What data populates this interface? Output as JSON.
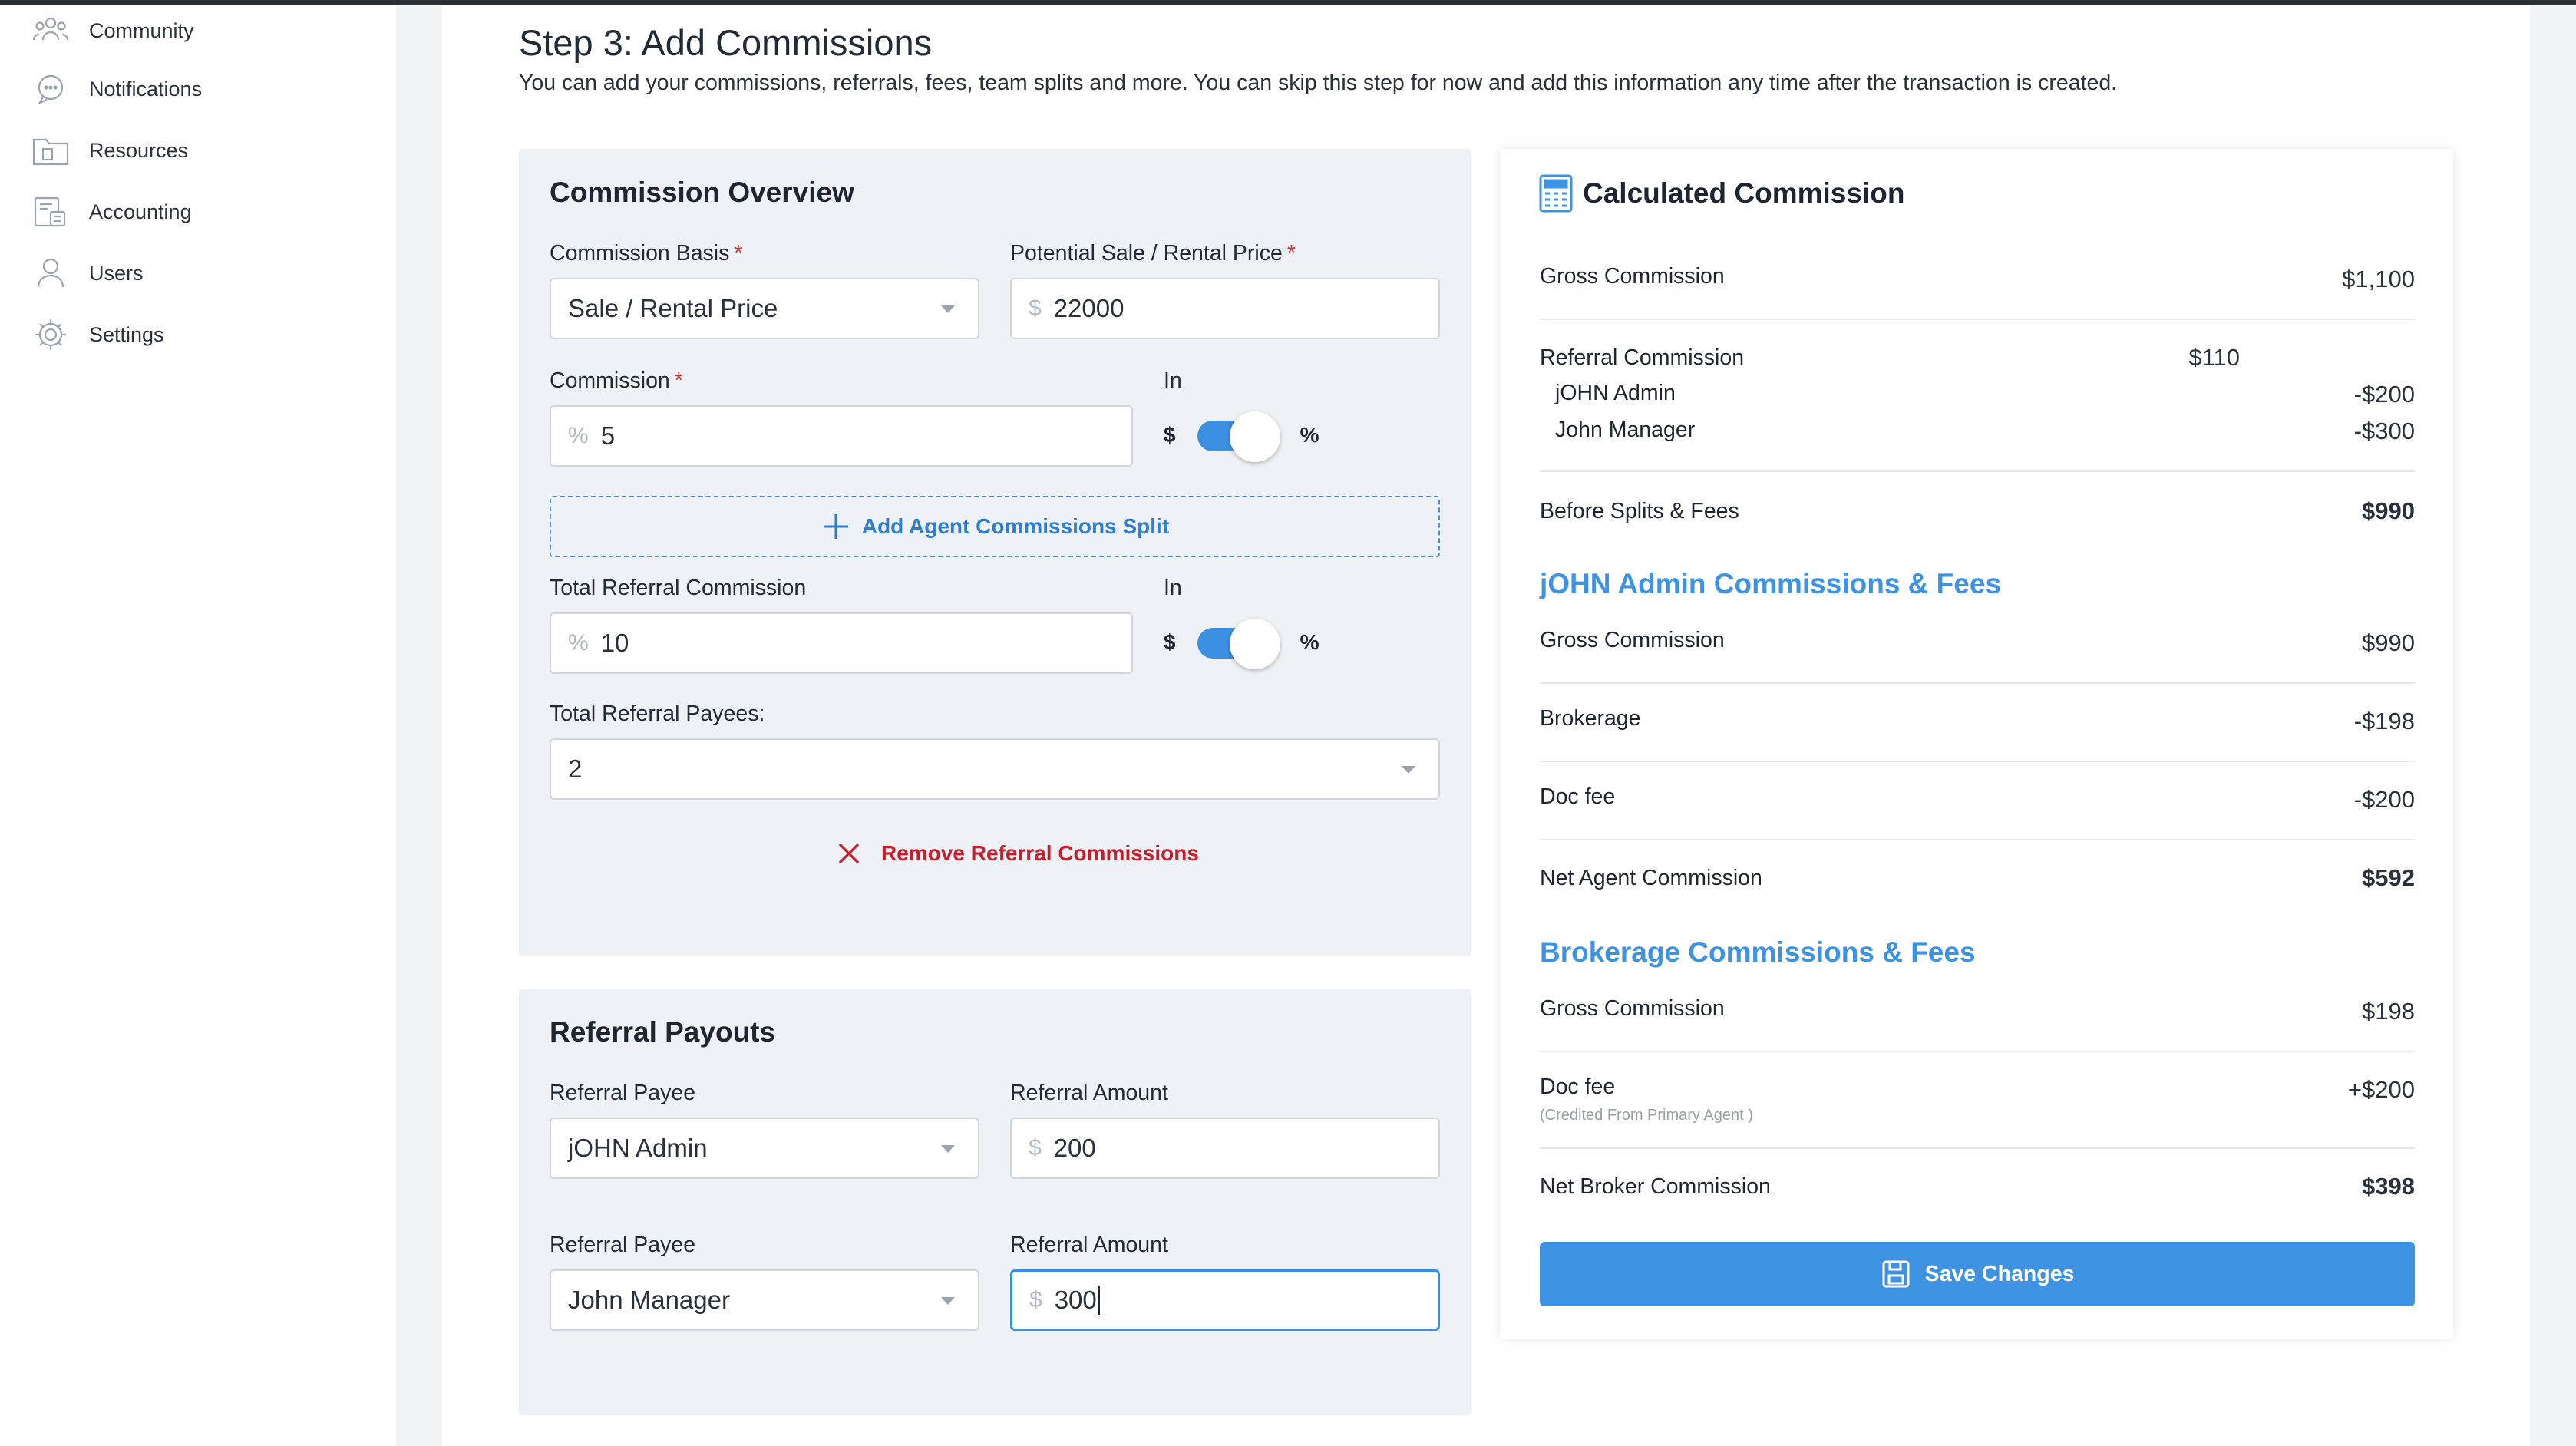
{
  "sidebar": {
    "items": [
      {
        "label": "Community",
        "icon": "community-icon"
      },
      {
        "label": "Notifications",
        "icon": "chat-bubble-icon"
      },
      {
        "label": "Resources",
        "icon": "folder-icon"
      },
      {
        "label": "Accounting",
        "icon": "accounting-icon"
      },
      {
        "label": "Users",
        "icon": "user-icon"
      },
      {
        "label": "Settings",
        "icon": "gear-icon"
      }
    ]
  },
  "page": {
    "title": "Step 3: Add Commissions",
    "description": "You can add your commissions, referrals, fees, team splits and more. You can skip this step for now and add this information any time after the transaction is created."
  },
  "overview": {
    "title": "Commission Overview",
    "basis_label": "Commission Basis",
    "basis_value": "Sale / Rental Price",
    "price_label": "Potential Sale / Rental Price",
    "price_prefix": "$",
    "price_value": "22000",
    "commission_label": "Commission",
    "commission_prefix": "%",
    "commission_value": "5",
    "in_label": "In",
    "toggle_left": "$",
    "toggle_right": "%",
    "add_split_label": "Add Agent Commissions Split",
    "referral_label": "Total Referral Commission",
    "referral_prefix": "%",
    "referral_value": "10",
    "payees_label": "Total Referral Payees:",
    "payees_value": "2",
    "remove_label": "Remove Referral Commissions"
  },
  "payouts": {
    "title": "Referral Payouts",
    "payee_label": "Referral Payee",
    "amount_label": "Referral Amount",
    "amount_prefix": "$",
    "rows": [
      {
        "payee": "jOHN Admin",
        "amount": "200"
      },
      {
        "payee": "John Manager",
        "amount": "300"
      }
    ]
  },
  "calc": {
    "title": "Calculated Commission",
    "gross_label": "Gross Commission",
    "gross_value": "$1,100",
    "referral_label": "Referral Commission",
    "referral_value": "$110",
    "referral_rows": [
      {
        "name": "jOHN Admin",
        "value": "-$200"
      },
      {
        "name": "John Manager",
        "value": "-$300"
      }
    ],
    "before_label": "Before Splits & Fees",
    "before_value": "$990",
    "agent_section": {
      "title": "jOHN Admin Commissions & Fees",
      "gross_label": "Gross Commission",
      "gross_value": "$990",
      "brokerage_label": "Brokerage",
      "brokerage_value": "-$198",
      "docfee_label": "Doc fee",
      "docfee_value": "-$200",
      "net_label": "Net Agent Commission",
      "net_value": "$592"
    },
    "broker_section": {
      "title": "Brokerage Commissions & Fees",
      "gross_label": "Gross Commission",
      "gross_value": "$198",
      "docfee_label": "Doc fee",
      "docfee_note": "(Credited From Primary Agent )",
      "docfee_value": "+$200",
      "net_label": "Net Broker Commission",
      "net_value": "$398"
    },
    "save_label": "Save Changes"
  },
  "colors": {
    "accent": "#3d92e2",
    "danger": "#c81e2c",
    "required": "#d63031",
    "panel": "#eef1f5"
  }
}
